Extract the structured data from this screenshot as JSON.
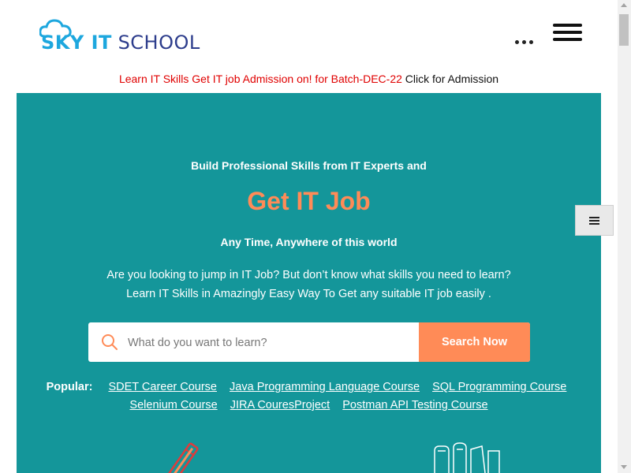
{
  "header": {
    "logo": {
      "sky": "SKY IT",
      "school": "SCHOOL",
      "icon": "cloud-icon"
    },
    "more_icon": "dots-icon",
    "menu_icon": "hamburger-icon"
  },
  "announcement": {
    "red_text": "Learn IT Skills Get IT job Admission on! for Batch-DEC-22",
    "link_text": "Click for Admission"
  },
  "hero": {
    "subtitle": "Build Professional Skills from IT Experts and",
    "title": "Get IT Job",
    "tagline": "Any Time, Anywhere of this world",
    "description_line1": "Are you looking to jump in IT Job? But don’t know what skills you need to learn?",
    "description_line2": "Learn IT Skills in Amazingly Easy Way To Get any suitable IT job easily .",
    "search": {
      "placeholder": "What do you want to learn?",
      "button": "Search Now",
      "icon": "search-icon"
    },
    "popular": {
      "label": "Popular:",
      "links": [
        "SDET Career Course",
        "Java Programming Language Course",
        "SQL Programming Course",
        "Selenium Course",
        "JIRA CouresProject",
        "Postman API Testing Course"
      ]
    }
  },
  "side_menu_icon": "list-icon",
  "colors": {
    "hero_bg": "#14969a",
    "accent": "#ff8b57",
    "logo_blue": "#1da7de",
    "logo_navy": "#2d3d8c",
    "announce_red": "#e00000"
  }
}
